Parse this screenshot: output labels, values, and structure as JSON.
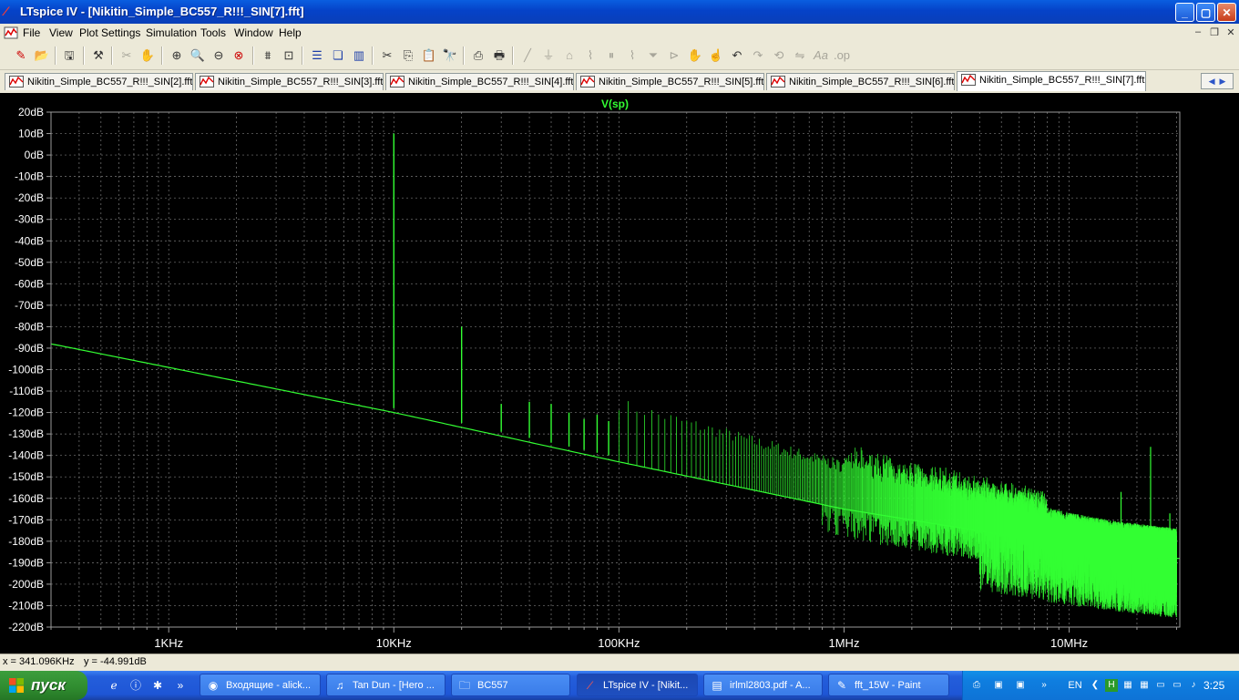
{
  "window": {
    "title": "LTspice IV - [Nikitin_Simple_BC557_R!!!_SIN[7].fft]",
    "controls": [
      "minimize",
      "maximize",
      "close"
    ]
  },
  "menu": [
    "File",
    "View",
    "Plot Settings",
    "Simulation",
    "Tools",
    "Window",
    "Help"
  ],
  "toolbar": {
    "icons": [
      "schematic-icon",
      "open-icon",
      "save-icon",
      "control-panel-icon",
      "autorange-icon",
      "pan-icon",
      "zoom-in-icon",
      "zoom-area-icon",
      "zoom-out-icon",
      "zoom-cancel-icon",
      "fft-icon",
      "autoscale-icon",
      "tile-horizontal-icon",
      "cascade-icon",
      "tile-vertical-icon",
      "cut-icon",
      "copy-icon",
      "paste-icon",
      "find-icon",
      "print-preview-icon",
      "print-icon",
      "wire-icon",
      "ground-icon",
      "label-icon",
      "resistor-icon",
      "capacitor-icon",
      "inductor-icon",
      "diode-icon",
      "component-icon",
      "move-icon",
      "drag-icon",
      "undo-icon",
      "redo-icon",
      "rotate-icon",
      "mirror-icon",
      "text-icon",
      "spice-directive-icon"
    ]
  },
  "tabs": [
    {
      "label": "Nikitin_Simple_BC557_R!!!_SIN[2].fft",
      "active": false
    },
    {
      "label": "Nikitin_Simple_BC557_R!!!_SIN[3].fft",
      "active": false
    },
    {
      "label": "Nikitin_Simple_BC557_R!!!_SIN[4].fft",
      "active": false
    },
    {
      "label": "Nikitin_Simple_BC557_R!!!_SIN[5].fft",
      "active": false
    },
    {
      "label": "Nikitin_Simple_BC557_R!!!_SIN[6].fft",
      "active": false
    },
    {
      "label": "Nikitin_Simple_BC557_R!!!_SIN[7].fft",
      "active": true
    }
  ],
  "chart_data": {
    "type": "line",
    "title": "V(sp)",
    "xscale": "log",
    "xlim_hz": [
      300,
      31000000
    ],
    "ylim_db": [
      -220,
      20
    ],
    "yticks": [
      "20dB",
      "10dB",
      "0dB",
      "-10dB",
      "-20dB",
      "-30dB",
      "-40dB",
      "-50dB",
      "-60dB",
      "-70dB",
      "-80dB",
      "-90dB",
      "-100dB",
      "-110dB",
      "-120dB",
      "-130dB",
      "-140dB",
      "-150dB",
      "-160dB",
      "-170dB",
      "-180dB",
      "-190dB",
      "-200dB",
      "-210dB",
      "-220dB"
    ],
    "xticks": [
      {
        "hz": 1000,
        "label": "1KHz"
      },
      {
        "hz": 10000,
        "label": "10KHz"
      },
      {
        "hz": 100000,
        "label": "100KHz"
      },
      {
        "hz": 1000000,
        "label": "1MHz"
      },
      {
        "hz": 10000000,
        "label": "10MHz"
      }
    ],
    "grid": true,
    "trace_color": "#33ff33",
    "noise_floor": [
      {
        "hz": 300,
        "db": -88
      },
      {
        "hz": 10000,
        "db": -120
      },
      {
        "hz": 100000,
        "db": -143
      },
      {
        "hz": 1000000,
        "db": -165
      },
      {
        "hz": 10000000,
        "db": -182
      },
      {
        "hz": 30000000,
        "db": -188
      }
    ],
    "harmonics": [
      {
        "hz": 10000,
        "db": 10
      },
      {
        "hz": 20000,
        "db": -80
      },
      {
        "hz": 30000,
        "db": -116
      },
      {
        "hz": 40000,
        "db": -115
      },
      {
        "hz": 50000,
        "db": -116
      },
      {
        "hz": 60000,
        "db": -120
      },
      {
        "hz": 70000,
        "db": -123
      },
      {
        "hz": 80000,
        "db": -121
      },
      {
        "hz": 90000,
        "db": -124
      }
    ],
    "high_freq_spurs": [
      {
        "hz": 17000000,
        "db": -157
      },
      {
        "hz": 23000000,
        "db": -136
      },
      {
        "hz": 28000000,
        "db": -167
      }
    ]
  },
  "status": {
    "x_readout": "x = 341.096KHz",
    "y_readout": "y = -44.991dB"
  },
  "taskbar": {
    "start_label": "пуск",
    "tasks": [
      {
        "label": "Входящие - alick...",
        "active": false
      },
      {
        "label": "Tan Dun - [Hero ...",
        "active": false
      },
      {
        "label": "BC557",
        "active": false
      },
      {
        "label": "LTspice IV - [Nikit...",
        "active": true
      },
      {
        "label": "irlml2803.pdf - A...",
        "active": false
      },
      {
        "label": "fft_15W - Paint",
        "active": false
      }
    ],
    "language": "EN",
    "clock": "3:25"
  }
}
